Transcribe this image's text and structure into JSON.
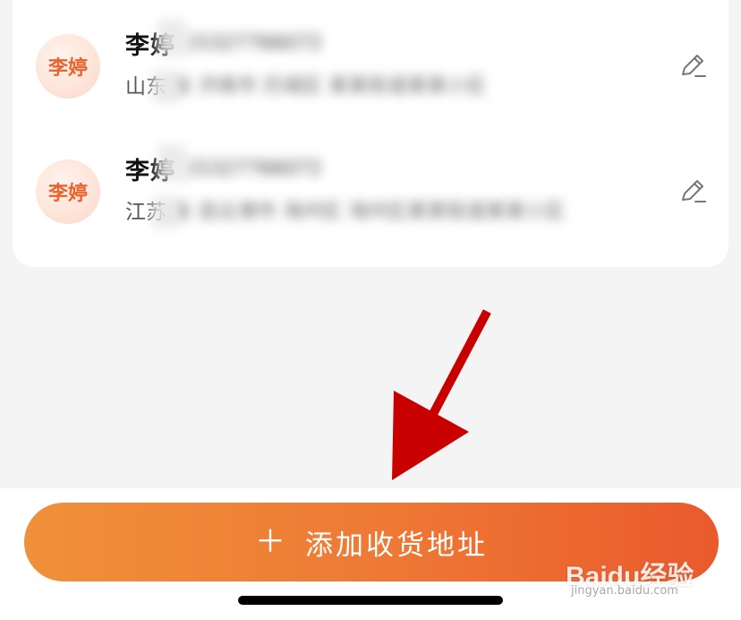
{
  "addresses": [
    {
      "avatar_text": "李婷",
      "name": "李婷",
      "phone": "15327766072",
      "address_prefix": "山东",
      "address_detail": "省 济南市 历城区 某某街道某某小区"
    },
    {
      "avatar_text": "李婷",
      "name": "李婷",
      "phone": "15327766072",
      "address_prefix": "江苏",
      "address_detail": "省 连云港市 海州区 海州区某某街道某某小区"
    }
  ],
  "add_button": {
    "icon": "plus-icon",
    "label": "添加收货地址"
  },
  "annotation": {
    "icon": "red-arrow-icon",
    "color": "#c80000"
  },
  "colors": {
    "accent": "#ee7a35",
    "avatar_text": "#e8632d"
  },
  "watermark": {
    "logo_text": "Baidu经验",
    "sub_text": "jingyan.baidu.com"
  }
}
